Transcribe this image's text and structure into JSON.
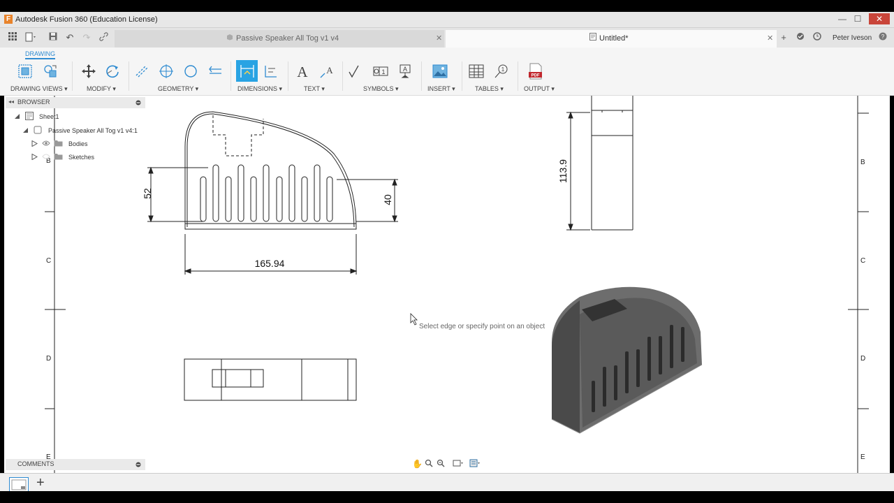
{
  "window": {
    "title": "Autodesk Fusion 360 (Education License)",
    "controls": [
      "—",
      "☐",
      "✕"
    ]
  },
  "tabs": [
    {
      "label": "Passive Speaker All Tog v1 v4"
    },
    {
      "label": "Untitled*"
    }
  ],
  "user": {
    "name": "Peter Iveson"
  },
  "workspace": {
    "label": "DRAWING"
  },
  "ribbon_groups": [
    {
      "label": "DRAWING VIEWS ▾"
    },
    {
      "label": "MODIFY ▾"
    },
    {
      "label": "GEOMETRY ▾"
    },
    {
      "label": "DIMENSIONS ▾"
    },
    {
      "label": "TEXT ▾"
    },
    {
      "label": "SYMBOLS ▾"
    },
    {
      "label": "INSERT ▾"
    },
    {
      "label": "TABLES ▾"
    },
    {
      "label": "OUTPUT ▾"
    }
  ],
  "browser": {
    "header": "BROWSER",
    "items": [
      {
        "label": "Sheet1"
      },
      {
        "label": "Passive Speaker All Tog v1 v4:1"
      },
      {
        "label": "Bodies"
      },
      {
        "label": "Sketches"
      }
    ]
  },
  "comments": {
    "header": "COMMENTS"
  },
  "drawing": {
    "dimensions": {
      "height_left": "52",
      "height_right": "40",
      "width": "165.94",
      "side_height": "113.9"
    },
    "zone_labels": [
      "B",
      "C",
      "D",
      "E"
    ],
    "tooltip": "Select edge or specify point on an object"
  },
  "colors": {
    "accent": "#2e8bd1",
    "active_tool": "#29a3e3",
    "pdf_red": "#c0272d"
  }
}
